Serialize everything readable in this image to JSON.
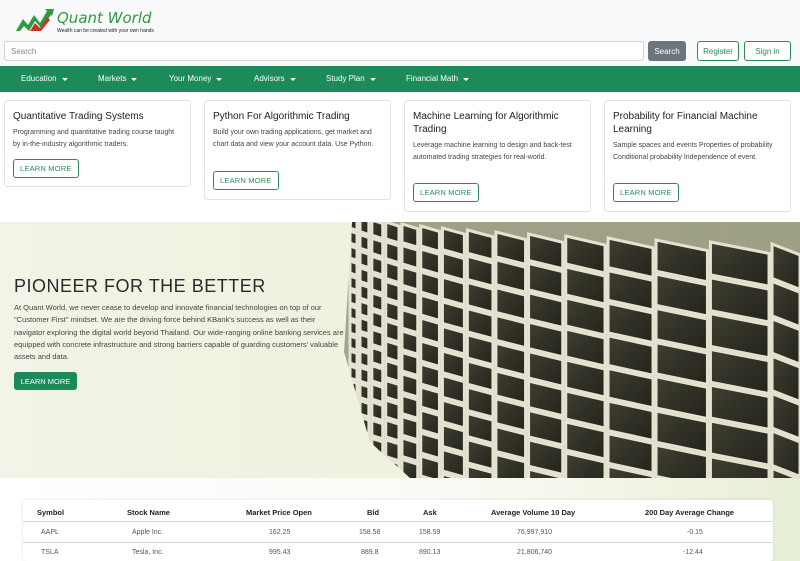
{
  "header": {
    "logo_title": "Quant World",
    "logo_tagline": "Wealth can be created with your own hands",
    "search_placeholder": "Search",
    "search_button": "Search",
    "register_button": "Register",
    "signin_button": "Sign in"
  },
  "nav": {
    "items": [
      {
        "label": "Education"
      },
      {
        "label": "Markets"
      },
      {
        "label": "Your Money"
      },
      {
        "label": "Advisors"
      },
      {
        "label": "Study Plan"
      },
      {
        "label": "Financial Math"
      }
    ]
  },
  "cards": [
    {
      "title": "Quantitative Trading Systems",
      "text": "Programming and quantitative trading course taught by in-the-industry algorithmic traders.",
      "button": "LEARN MORE"
    },
    {
      "title": "Python For Algorithmic Trading",
      "text": "Build your own trading applications, get market and chart data and view your account data. Use Python.",
      "button": "LEARN MORE"
    },
    {
      "title": "Machine Learning for Algorithmic Trading",
      "text": "Leverage machine learning to design and back-test automated trading strategies for real-world.",
      "button": "LEARN MORE"
    },
    {
      "title": "Probability for Financial Machine Learning",
      "text": "Sample spaces and events Properties of probability Conditional probability Independence of event.",
      "button": "LEARN MORE"
    }
  ],
  "hero": {
    "title": "PIONEER FOR THE BETTER",
    "text": "At Quant World, we never cease to develop and innovate financial technologies on top of our \"Customer First\" mindset. We are the driving force behind KBank's success as well as their navigator exploring the digital world beyond Thailand. Our wide-ranging online banking services are equipped with concrete infrastructure and strong barriers capable of guarding customers' valuable assets and data.",
    "button": "LEARN MORE"
  },
  "stocks": {
    "columns": [
      "Symbol",
      "Stock Name",
      "Market Price Open",
      "Bid",
      "Ask",
      "Average Volume 10 Day",
      "200 Day Average Change"
    ],
    "rows": [
      [
        "AAPL",
        "Apple Inc.",
        "162.25",
        "158.58",
        "158.59",
        "76,997,910",
        "-0.15"
      ],
      [
        "TSLA",
        "Tesla, Inc.",
        "995.43",
        "889.8",
        "890.13",
        "21,806,740",
        "-12.44"
      ]
    ]
  },
  "colors": {
    "brand_green": "#1c8a5a",
    "logo_green": "#2f9a3e",
    "search_button_gray": "#6c757d"
  }
}
